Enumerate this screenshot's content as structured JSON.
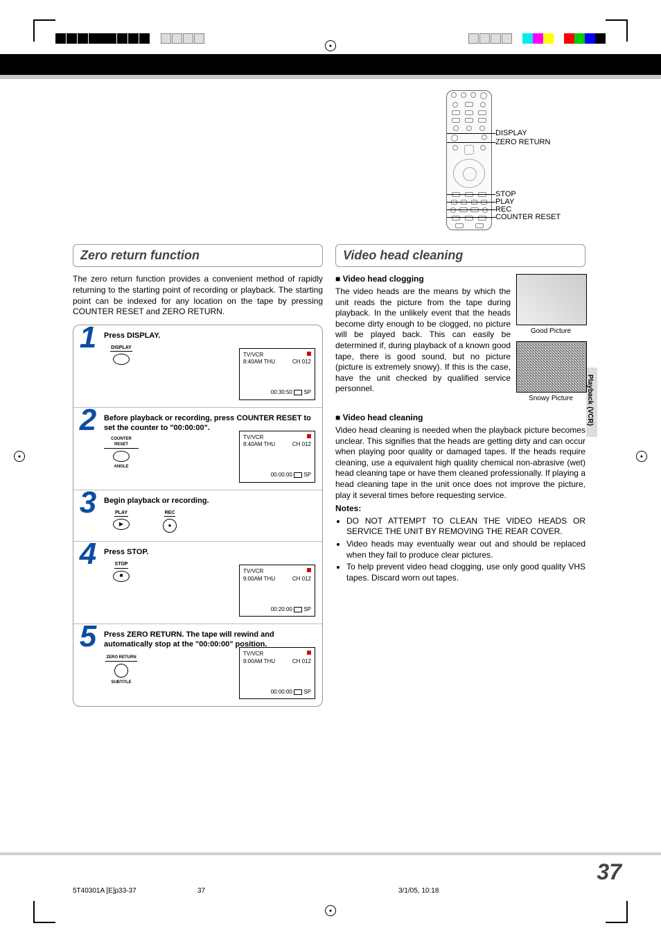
{
  "page_number": "37",
  "footer": {
    "doc_id": "5T40301A [E]p33-37",
    "page": "37",
    "date": "3/1/05, 10:18"
  },
  "side_tab": "Playback (VCR)",
  "remote_labels": {
    "display": "DISPLAY",
    "zero_return": "ZERO RETURN",
    "stop": "STOP",
    "play": "PLAY",
    "rec": "REC",
    "counter_reset": "COUNTER RESET"
  },
  "left": {
    "heading": "Zero return function",
    "intro": "The zero return function provides a convenient method of rapidly returning to the starting point of recording or playback. The starting point can be indexed for any location on the tape by pressing COUNTER RESET and ZERO RETURN.",
    "steps": [
      {
        "num": "1",
        "inst": "Press DISPLAY.",
        "button_label": "DISPLAY",
        "button_sub": "",
        "screen": {
          "mode": "TV/VCR",
          "time": "8:40AM  THU",
          "ch": "CH 012",
          "counter": "00:30:50",
          "speed": "SP"
        }
      },
      {
        "num": "2",
        "inst": "Before playback or recording, press COUNTER RESET to set the counter to \"00:00:00\".",
        "button_label": "COUNTER RESET",
        "button_sub": "ANGLE",
        "screen": {
          "mode": "TV/VCR",
          "time": "8:40AM  THU",
          "ch": "CH 012",
          "counter": "00:00:00",
          "speed": "SP"
        }
      },
      {
        "num": "3",
        "inst": "Begin playback or recording.",
        "button_label": "PLAY",
        "button_sub": "",
        "button2_label": "REC",
        "short": true
      },
      {
        "num": "4",
        "inst": "Press STOP.",
        "button_label": "STOP",
        "button_sub": "",
        "screen": {
          "mode": "TV/VCR",
          "time": "9:00AM  THU",
          "ch": "CH 012",
          "counter": "00:20:00",
          "speed": "SP"
        }
      },
      {
        "num": "5",
        "inst": "Press ZERO RETURN. The tape will rewind and automatically stop at the \"00:00:00\" position.",
        "button_label": "ZERO RETURN",
        "button_sub": "SUBTITLE",
        "screen": {
          "mode": "TV/VCR",
          "time": "9:00AM  THU",
          "ch": "CH 012",
          "counter": "00:00:00",
          "speed": "SP"
        }
      }
    ]
  },
  "right": {
    "heading": "Video head cleaning",
    "sub1_hdr": "Video head clogging",
    "sub1_body": "The video heads are the means by which the unit reads the picture from the tape during playback. In the unlikely event that the heads become dirty enough to be clogged, no picture will be played back. This can easily be determined if, during playback of a known good tape, there is good sound, but no picture (picture is extremely snowy). If this is the case, have the unit checked by qualified service personnel.",
    "cap_good": "Good Picture",
    "cap_snow": "Snowy Picture",
    "sub2_hdr": "Video head cleaning",
    "sub2_body": "Video head cleaning is needed when the playback picture becomes unclear. This signifies that the heads are getting dirty and can occur when playing poor quality or damaged tapes. If the heads require cleaning, use a equivalent high quality chemical non-abrasive (wet) head cleaning tape or have them cleaned professionally. If playing a head cleaning tape in the unit once does not improve the picture, play it several times before requesting service.",
    "notes_hdr": "Notes:",
    "notes": [
      "DO NOT ATTEMPT TO CLEAN THE VIDEO HEADS OR SERVICE THE UNIT BY REMOVING THE REAR COVER.",
      "Video heads may eventually wear out and should be replaced when they fail to produce clear pictures.",
      "To help prevent video head clogging, use only good quality VHS tapes. Discard worn out tapes."
    ]
  }
}
